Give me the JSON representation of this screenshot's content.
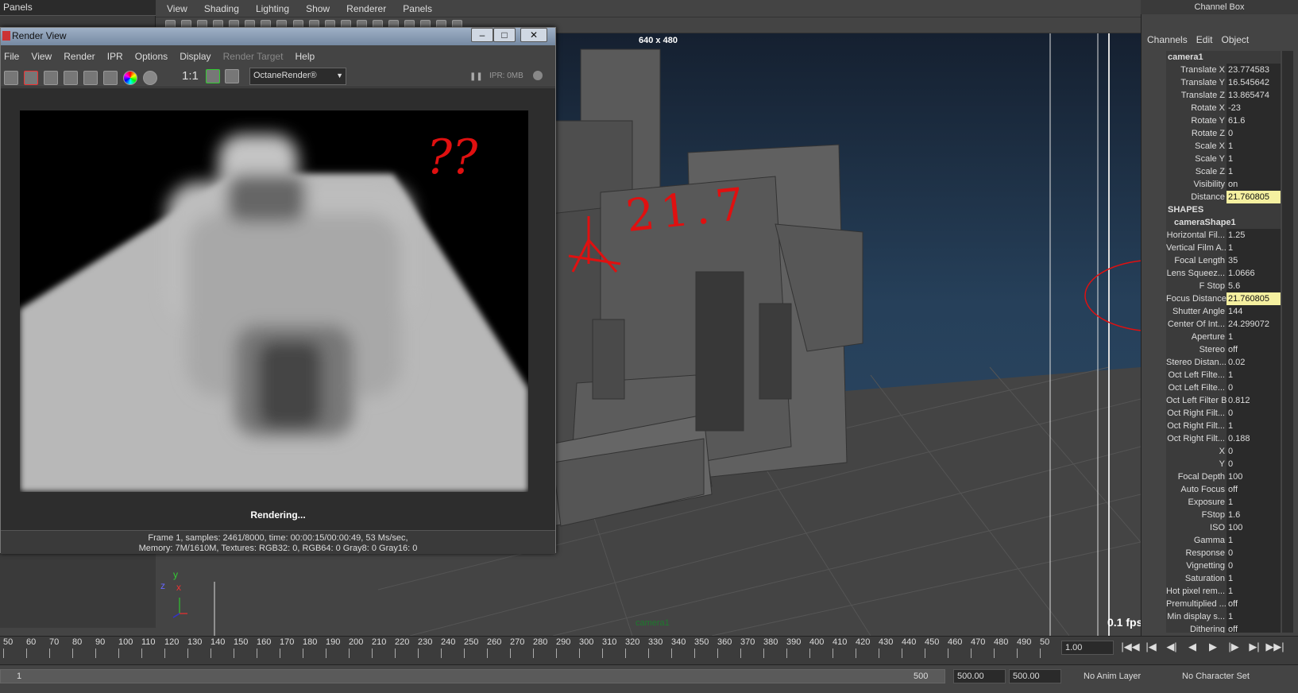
{
  "left_panel": {
    "title": "Panels"
  },
  "viewport": {
    "menu": [
      "View",
      "Shading",
      "Lighting",
      "Show",
      "Renderer",
      "Panels"
    ],
    "resolution": "640 x 480",
    "fps": "0.1 fps",
    "camera_label": "camera1",
    "annotation_distance": "21.7",
    "axis": {
      "y": "y",
      "z": "z",
      "x": "x"
    }
  },
  "render_view": {
    "title": "Render View",
    "menu": [
      "File",
      "View",
      "Render",
      "IPR",
      "Options",
      "Display",
      "Render Target",
      "Help"
    ],
    "ratio_label": "1:1",
    "renderer": "OctaneRender®",
    "ipr_status": "IPR: 0MB",
    "annotation": "??",
    "rendering_label": "Rendering...",
    "status_line1": "Frame 1, samples: 2461/8000, time: 00:00:15/00:00:49, 53 Ms/sec,",
    "status_line2": "Memory: 7M/1610M, Textures: RGB32: 0, RGB64: 0 Gray8: 0 Gray16: 0"
  },
  "channel_box": {
    "title": "Channel Box",
    "tabs": [
      "Channels",
      "Edit",
      "Object"
    ],
    "object": "camera1",
    "rows": [
      {
        "label": "Translate X",
        "value": "23.774583"
      },
      {
        "label": "Translate Y",
        "value": "16.545642"
      },
      {
        "label": "Translate Z",
        "value": "13.865474"
      },
      {
        "label": "Rotate X",
        "value": "-23"
      },
      {
        "label": "Rotate Y",
        "value": "61.6"
      },
      {
        "label": "Rotate Z",
        "value": "0"
      },
      {
        "label": "Scale X",
        "value": "1"
      },
      {
        "label": "Scale Y",
        "value": "1"
      },
      {
        "label": "Scale Z",
        "value": "1"
      },
      {
        "label": "Visibility",
        "value": "on"
      },
      {
        "label": "Distance",
        "value": "21.760805",
        "highlight": true
      }
    ],
    "shapes_header": "SHAPES",
    "shape_name": "cameraShape1",
    "shape_rows": [
      {
        "label": "Horizontal Fil...",
        "value": "1.25"
      },
      {
        "label": "Vertical Film A...",
        "value": "1"
      },
      {
        "label": "Focal Length",
        "value": "35"
      },
      {
        "label": "Lens Squeez...",
        "value": "1.0666"
      },
      {
        "label": "F Stop",
        "value": "5.6"
      },
      {
        "label": "Focus Distance",
        "value": "21.760805",
        "highlight": true
      },
      {
        "label": "Shutter Angle",
        "value": "144"
      },
      {
        "label": "Center Of Int...",
        "value": "24.299072"
      },
      {
        "label": "Aperture",
        "value": "1"
      },
      {
        "label": "Stereo",
        "value": "off"
      },
      {
        "label": "Stereo Distan...",
        "value": "0.02"
      },
      {
        "label": "Oct Left Filte...",
        "value": "1"
      },
      {
        "label": "Oct Left Filte...",
        "value": "0"
      },
      {
        "label": "Oct Left Filter B",
        "value": "0.812"
      },
      {
        "label": "Oct Right Filt...",
        "value": "0"
      },
      {
        "label": "Oct Right Filt...",
        "value": "1"
      },
      {
        "label": "Oct Right Filt...",
        "value": "0.188"
      },
      {
        "label": "X",
        "value": "0"
      },
      {
        "label": "Y",
        "value": "0"
      },
      {
        "label": "Focal Depth",
        "value": "100"
      },
      {
        "label": "Auto Focus",
        "value": "off"
      },
      {
        "label": "Exposure",
        "value": "1"
      },
      {
        "label": "FStop",
        "value": "1.6"
      },
      {
        "label": "ISO",
        "value": "100"
      },
      {
        "label": "Gamma",
        "value": "1"
      },
      {
        "label": "Response",
        "value": "0"
      },
      {
        "label": "Vignetting",
        "value": "0"
      },
      {
        "label": "Saturation",
        "value": "1"
      },
      {
        "label": "Hot pixel rem...",
        "value": "1"
      },
      {
        "label": "Premultiplied ...",
        "value": "off"
      },
      {
        "label": "Min display s...",
        "value": "1"
      },
      {
        "label": "Dithering",
        "value": "off"
      }
    ]
  },
  "timeline": {
    "ticks": [
      "50",
      "60",
      "70",
      "80",
      "90",
      "100",
      "110",
      "120",
      "130",
      "140",
      "150",
      "160",
      "170",
      "180",
      "190",
      "200",
      "210",
      "220",
      "230",
      "240",
      "250",
      "260",
      "270",
      "280",
      "290",
      "300",
      "310",
      "320",
      "330",
      "340",
      "350",
      "360",
      "370",
      "380",
      "390",
      "400",
      "410",
      "420",
      "430",
      "440",
      "450",
      "460",
      "470",
      "480",
      "490",
      "50"
    ],
    "current_frame": "1.00",
    "playback_icons": [
      "|◀◀",
      "|◀",
      "◀|",
      "◀",
      "▶",
      "|▶",
      "▶|",
      "▶▶|"
    ]
  },
  "range": {
    "start_value": "1",
    "slider_end": "500",
    "start_field": "500.00",
    "end_field": "500.00",
    "anim_layer": "No Anim Layer",
    "character_set": "No Character Set"
  },
  "colors": {
    "highlight": "#f5f0a0",
    "annotation": "#e01010",
    "camera_green": "#1d7a2d"
  }
}
